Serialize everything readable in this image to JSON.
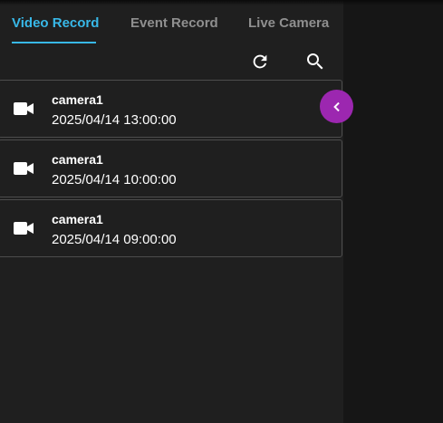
{
  "colors": {
    "accent": "#38b8e8",
    "collapse_button": "#9c27b0",
    "panel_bg": "#1f1f1f",
    "page_bg": "#161616"
  },
  "tabs": [
    {
      "label": "Video Record",
      "active": true
    },
    {
      "label": "Event Record",
      "active": false
    },
    {
      "label": "Live Camera",
      "active": false
    }
  ],
  "toolbar": {
    "refresh_icon": "refresh-icon",
    "search_icon": "search-icon"
  },
  "records": [
    {
      "camera": "camera1",
      "datetime": "2025/04/14 13:00:00",
      "icon": "video-camera-icon"
    },
    {
      "camera": "camera1",
      "datetime": "2025/04/14 10:00:00",
      "icon": "video-camera-icon"
    },
    {
      "camera": "camera1",
      "datetime": "2025/04/14 09:00:00",
      "icon": "video-camera-icon"
    }
  ],
  "collapse_button": {
    "icon": "chevron-left-icon"
  }
}
